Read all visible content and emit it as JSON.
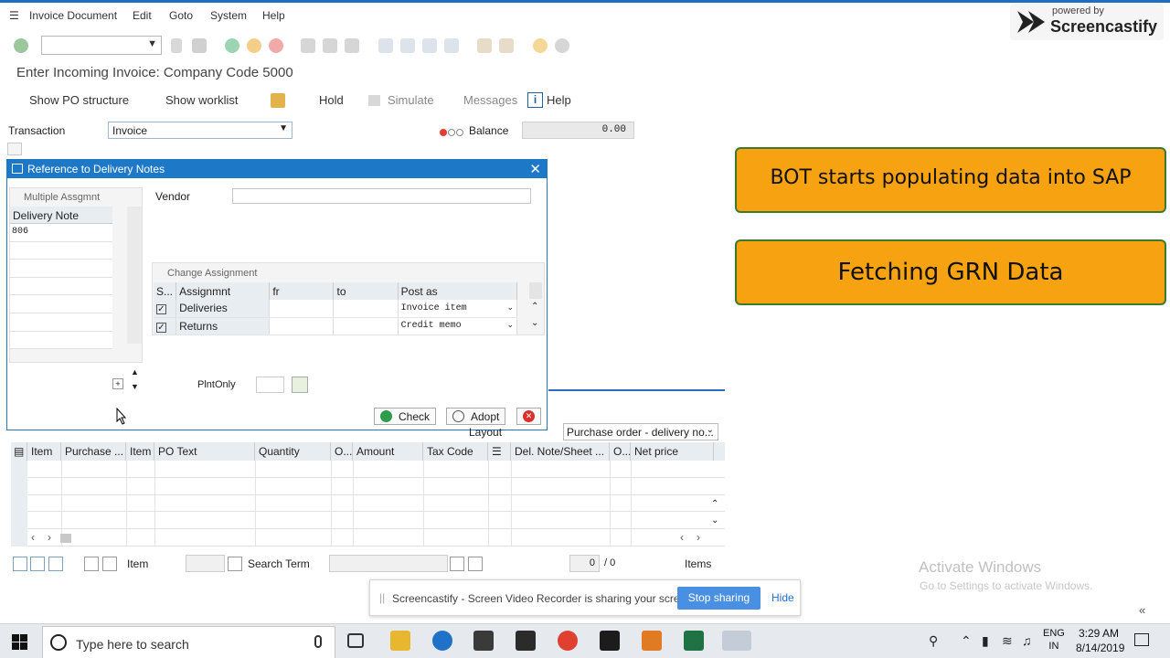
{
  "menubar": {
    "items": [
      "Invoice Document",
      "Edit",
      "Goto",
      "System",
      "Help"
    ]
  },
  "page": {
    "title": "Enter Incoming Invoice: Company Code 5000"
  },
  "app_toolbar": {
    "show_po": "Show PO structure",
    "show_worklist": "Show worklist",
    "hold": "Hold",
    "simulate": "Simulate",
    "messages": "Messages",
    "help": "Help"
  },
  "header": {
    "transaction_label": "Transaction",
    "transaction_value": "Invoice",
    "balance_label": "Balance",
    "balance_value": "0.00"
  },
  "dialog": {
    "title": "Reference to Delivery Notes",
    "multi_assign_label": "Multiple Assgmnt",
    "delivery_note_header": "Delivery Note",
    "delivery_notes": [
      "806",
      "",
      "",
      "",
      "",
      "",
      ""
    ],
    "vendor_label": "Vendor",
    "vendor_value": "",
    "change_assign_label": "Change Assignment",
    "ca_columns": [
      "S...",
      "Assignmnt",
      "fr",
      "to",
      "Post as"
    ],
    "ca_rows": [
      {
        "assignment": "Deliveries",
        "post_as": "Invoice item",
        "checked": true
      },
      {
        "assignment": "Returns",
        "post_as": "Credit memo",
        "checked": true
      }
    ],
    "plnt_label": "PlntOnly",
    "check_label": "Check",
    "adopt_label": "Adopt"
  },
  "items": {
    "layout_label": "Layout",
    "layout_value": "Purchase order - delivery no...",
    "columns": [
      "Item",
      "Purchase ...",
      "Item",
      "PO Text",
      "Quantity",
      "O...",
      "Amount",
      "Tax Code",
      "",
      "Del. Note/Sheet ...",
      "O...",
      "Net price"
    ]
  },
  "bottom": {
    "item_label": "Item",
    "search_label": "Search Term",
    "count": "0",
    "total": "/  0",
    "items_label": "Items"
  },
  "callouts": {
    "first": "BOT starts populating data into SAP",
    "second": "Fetching GRN Data"
  },
  "screencastify": {
    "powered": "powered by",
    "name": "Screencastify",
    "share_text": "Screencastify - Screen Video Recorder is sharing your screen.",
    "stop": "Stop sharing",
    "hide": "Hide"
  },
  "windows": {
    "activate_title": "Activate Windows",
    "activate_sub": "Go to Settings to activate Windows.",
    "search_placeholder": "Type here to search",
    "lang_1": "ENG",
    "lang_2": "IN",
    "time": "3:29 AM",
    "date": "8/14/2019"
  },
  "colors": {
    "accent": "#1e78c8",
    "callout": "#f7a211",
    "callout_border": "#3d7a2e",
    "stop_button": "#4a90e2"
  }
}
